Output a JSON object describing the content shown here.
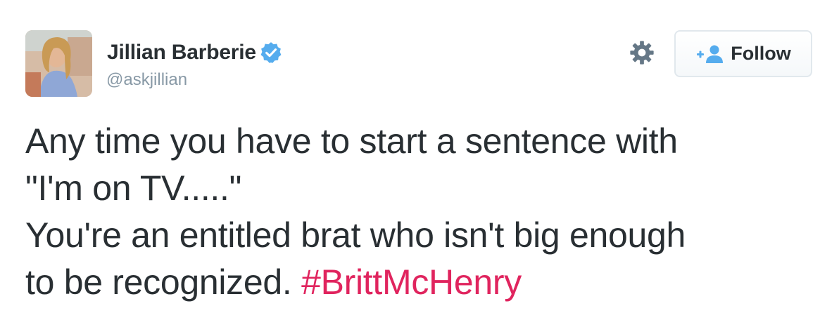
{
  "user": {
    "display_name": "Jillian Barberie",
    "handle": "@askjillian",
    "verified": true,
    "avatar_icon": "profile-photo"
  },
  "actions": {
    "settings_icon": "gear-icon",
    "follow_label": "Follow",
    "follow_icon": "add-user-icon"
  },
  "tweet": {
    "lines": [
      "Any time you have to start a sentence with",
      "\"I'm on TV.....\"",
      "You're an entitled brat who isn't big enough",
      "to be recognized. "
    ],
    "hashtag": "#BrittMcHenry"
  },
  "colors": {
    "text": "#292f33",
    "muted": "#8899a6",
    "verified_blue": "#55acee",
    "hashtag": "#e0245e",
    "border": "#e1e8ed"
  }
}
